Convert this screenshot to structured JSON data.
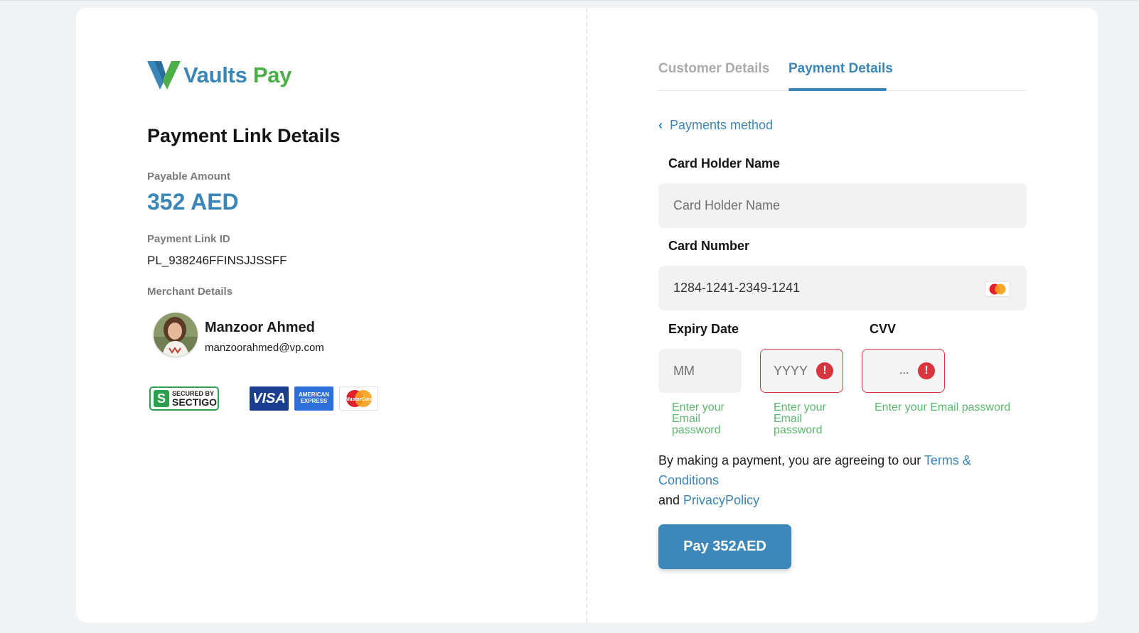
{
  "brand": {
    "name_part1": "Vaults",
    "name_part2": "Pay",
    "primary_color": "#3a86b8",
    "accent_color": "#4cae46"
  },
  "details": {
    "title": "Payment Link Details",
    "payable_label": "Payable Amount",
    "amount": "352 AED",
    "link_id_label": "Payment Link ID",
    "link_id": "PL_938246FFINSJJSSFF",
    "merchant_label": "Merchant Details",
    "merchant_name": "Manzoor Ahmed",
    "merchant_email": "manzoorahmed@vp.com"
  },
  "badges": {
    "sectigo_line1": "SECURED BY",
    "sectigo_line2": "SECTIGO",
    "visa": "VISA",
    "amex_line1": "AMERICAN",
    "amex_line2": "EXPRESS",
    "mastercard": "MasterCard"
  },
  "tabs": [
    {
      "label": "Customer Details",
      "active": false
    },
    {
      "label": "Payment Details",
      "active": true
    }
  ],
  "back_link": "Payments method",
  "form": {
    "card_holder_label": "Card Holder Name",
    "card_holder_placeholder": "Card Holder Name",
    "card_number_label": "Card Number",
    "card_number_value": "1284-1241-2349-1241",
    "expiry_label": "Expiry Date",
    "month_placeholder": "MM",
    "year_placeholder": "YYYY",
    "cvv_label": "CVV",
    "cvv_value": "...",
    "error_icon": "!",
    "hint_month": "Enter your Email password",
    "hint_year": "Enter your Email password",
    "hint_cvv": "Enter your Email password",
    "error_color": "#d8353f",
    "hint_color": "#5ab86b"
  },
  "terms": {
    "prefix": "By making a payment, you are agreeing to our ",
    "terms_link": "Terms & Conditions",
    "middle": "and ",
    "privacy_link": "PrivacyPolicy"
  },
  "pay_button": "Pay 352AED"
}
